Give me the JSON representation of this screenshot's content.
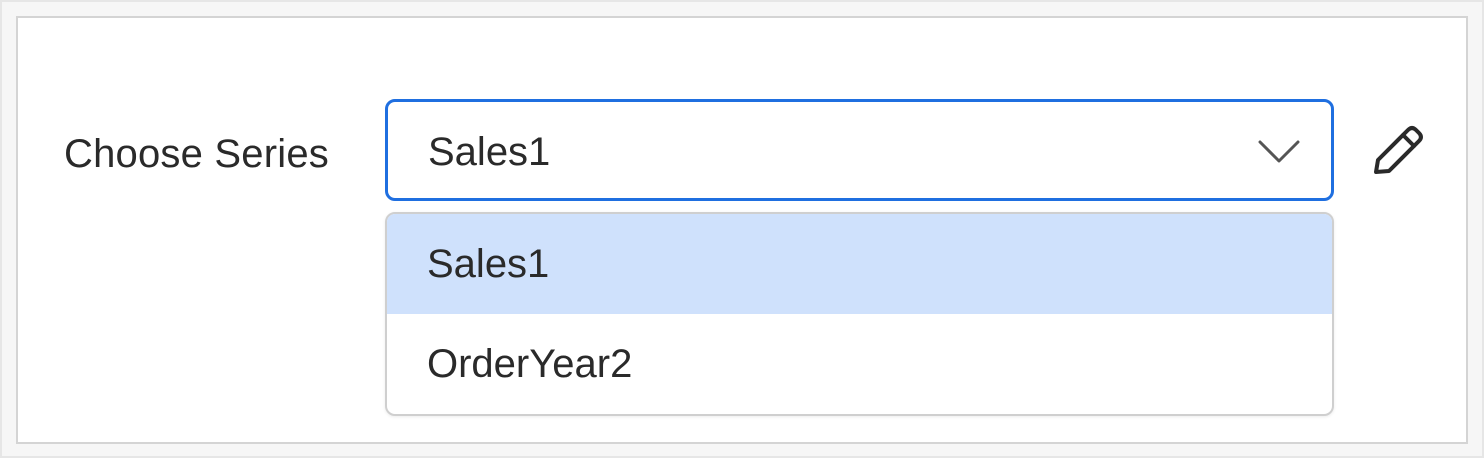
{
  "form": {
    "label": "Choose Series"
  },
  "select": {
    "selected_value": "Sales1",
    "open": true
  },
  "dropdown": {
    "options": [
      {
        "label": "Sales1",
        "selected": true
      },
      {
        "label": "OrderYear2",
        "selected": false
      }
    ]
  },
  "icons": {
    "chevron": "chevron-down-icon",
    "edit": "pencil-icon"
  },
  "colors": {
    "focus_border": "#1f6fe0",
    "selected_option_bg": "#cfe1fc",
    "text": "#2a2a2a"
  }
}
